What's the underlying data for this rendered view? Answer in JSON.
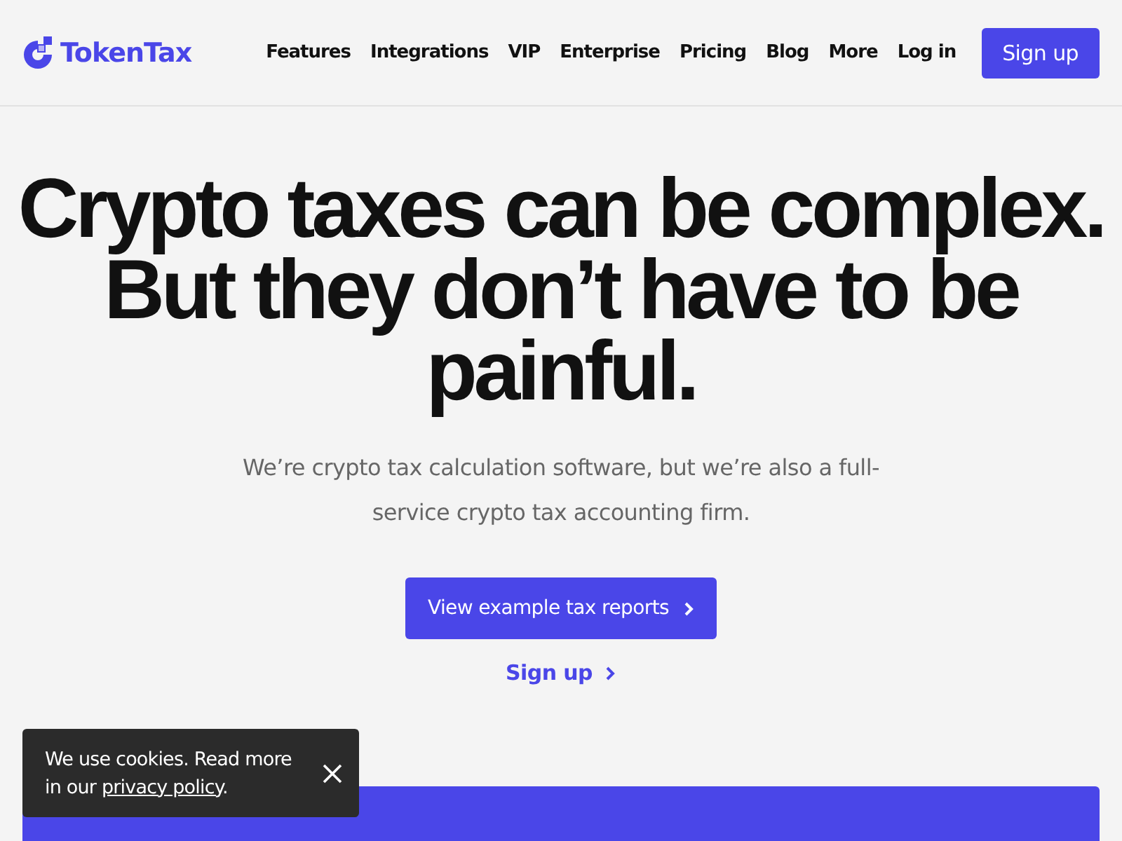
{
  "header": {
    "logo": "TokenTax",
    "nav": [
      "Features",
      "Integrations",
      "VIP",
      "Enterprise",
      "Pricing",
      "Blog",
      "More"
    ],
    "login": "Log in",
    "signup": "Sign up"
  },
  "hero": {
    "headline": [
      "Crypto taxes can be complex.",
      "But they don’t have to be painful."
    ],
    "subtitle": "We’re crypto tax calculation software, but we’re also a full-service crypto tax accounting firm.",
    "primary_button": "View example tax reports",
    "secondary_link": "Sign up"
  },
  "cookie_banner": {
    "text_before": "We use cookies. Read more in our ",
    "link": "privacy policy",
    "text_after": "."
  }
}
